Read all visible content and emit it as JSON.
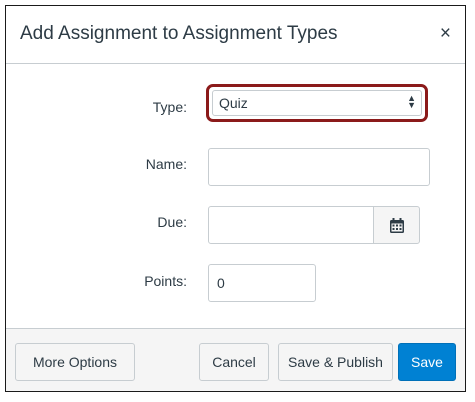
{
  "dialog": {
    "title": "Add Assignment to Assignment Types",
    "close_symbol": "×"
  },
  "form": {
    "type_label": "Type:",
    "type_value": "Quiz",
    "name_label": "Name:",
    "name_value": "",
    "due_label": "Due:",
    "due_value": "",
    "points_label": "Points:",
    "points_value": "0"
  },
  "footer": {
    "more_options_label": "More Options",
    "cancel_label": "Cancel",
    "save_publish_label": "Save & Publish",
    "save_label": "Save"
  },
  "colors": {
    "highlight_border": "#8b1a1a",
    "primary_button": "#0081d3"
  },
  "icons": {
    "close": "close-icon",
    "select_arrows": "select-arrows-icon",
    "calendar": "calendar-icon"
  }
}
